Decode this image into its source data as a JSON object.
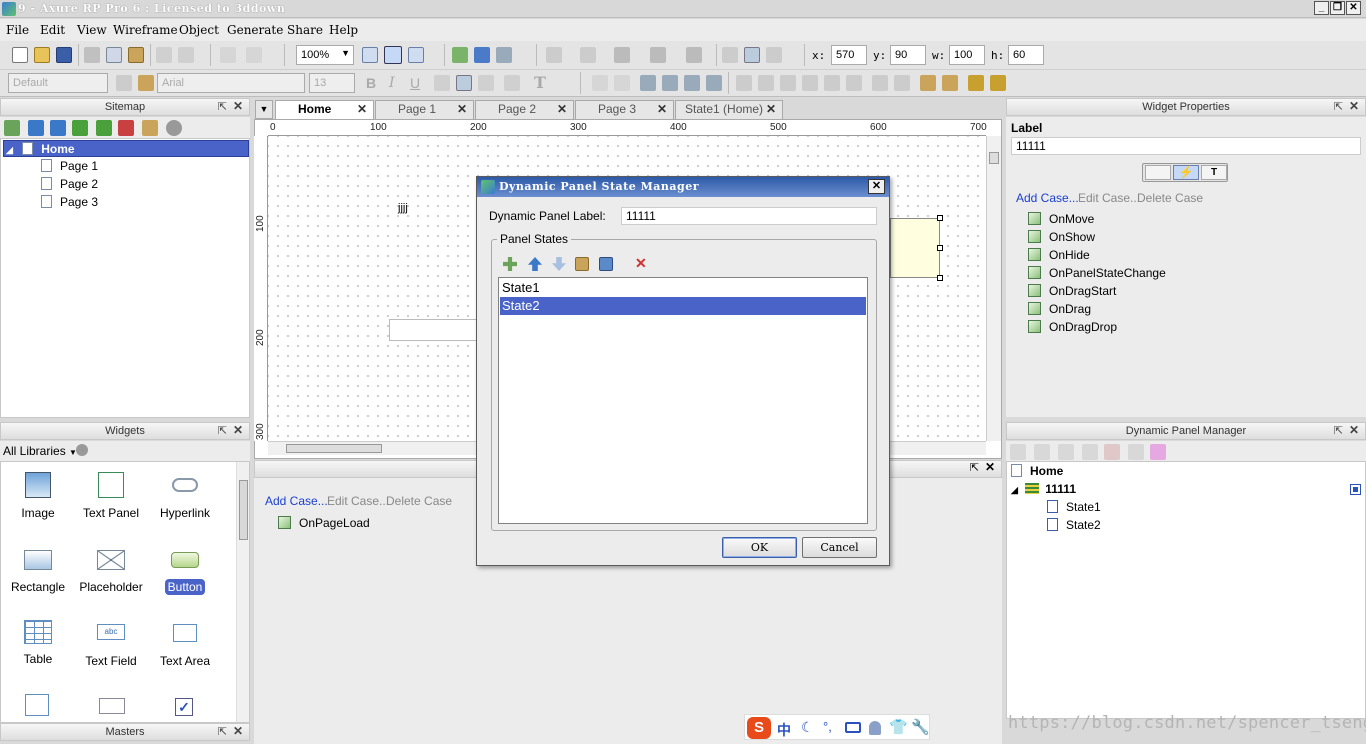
{
  "window": {
    "title": "9 - Axure RP Pro 6 : Licensed to 3ddown",
    "minimize": "_",
    "restore": "❐",
    "close": "✕"
  },
  "menu": [
    "File",
    "Edit",
    "View",
    "Wireframe",
    "Object",
    "Generate",
    "Share",
    "Help"
  ],
  "toolbar": {
    "zoom": "100%",
    "x_label": "x:",
    "x": "570",
    "y_label": "y:",
    "y": "90",
    "w_label": "w:",
    "w": "100",
    "h_label": "h:",
    "h": "60",
    "style_default": "Default",
    "font_family": "Arial",
    "font_size": "13",
    "bold": "B",
    "italic": "I",
    "underline": "U",
    "text_tool": "T"
  },
  "sitemap": {
    "title": "Sitemap",
    "pages": [
      "Home",
      "Page 1",
      "Page 2",
      "Page 3"
    ]
  },
  "widgets": {
    "title": "Widgets",
    "library": "All Libraries",
    "items": [
      "Image",
      "Text Panel",
      "Hyperlink",
      "Rectangle",
      "Placeholder",
      "Button",
      "Table",
      "Text Field",
      "Text Area"
    ]
  },
  "masters": {
    "title": "Masters"
  },
  "tabs": [
    "Home",
    "Page 1",
    "Page 2",
    "Page 3",
    "State1 (Home)"
  ],
  "rulers": {
    "top": [
      "0",
      "100",
      "200",
      "300",
      "400",
      "500",
      "600",
      "700"
    ],
    "left": [
      "100",
      "200",
      "300"
    ]
  },
  "canvas": {
    "text": "jjjj"
  },
  "page_interactions": {
    "add_case": "Add Case...",
    "edit_case": "Edit Case...",
    "delete_case": "Delete Case",
    "event": "OnPageLoad"
  },
  "widget_properties": {
    "title": "Widget Properties",
    "label_heading": "Label",
    "label_value": "11111",
    "add_case": "Add Case...",
    "edit_case": "Edit Case...",
    "delete_case": "Delete Case",
    "events": [
      "OnMove",
      "OnShow",
      "OnHide",
      "OnPanelStateChange",
      "OnDragStart",
      "OnDrag",
      "OnDragDrop"
    ]
  },
  "dynamic_panel_manager": {
    "title": "Dynamic Panel Manager",
    "page": "Home",
    "panel": "11111",
    "states": [
      "State1",
      "State2"
    ]
  },
  "dialog": {
    "title": "Dynamic Panel State Manager",
    "label_caption": "Dynamic Panel Label:",
    "label_value": "11111",
    "group_title": "Panel States",
    "states": [
      "State1",
      "State2"
    ],
    "selected_state": "State2",
    "ok": "OK",
    "cancel": "Cancel"
  },
  "watermark": "https://blog.csdn.net/spencer_tseng",
  "colors": {
    "selection": "#4a63c8",
    "link": "#1a3fd0",
    "dialog_title": "#2c5aa8",
    "panel_fill": "#ffffe0"
  }
}
